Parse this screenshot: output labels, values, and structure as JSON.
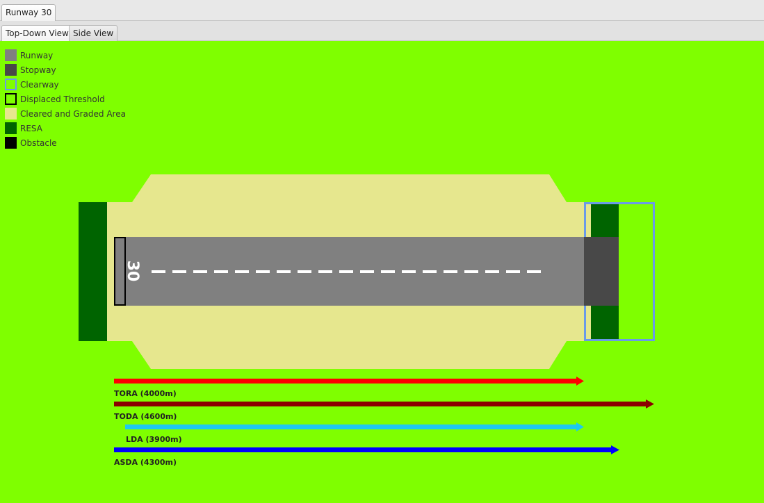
{
  "window": {
    "top_tab": "Runway 30",
    "view_tabs": [
      "Top-Down View",
      "Side View"
    ],
    "active_view": "Top-Down View"
  },
  "legend": [
    {
      "label": "Runway",
      "color": "#808080",
      "outline": false
    },
    {
      "label": "Stopway",
      "color": "#484848",
      "outline": false
    },
    {
      "label": "Clearway",
      "color": "#7fff00",
      "outline": true,
      "outline_color": "#6a9be8"
    },
    {
      "label": "Displaced Threshold",
      "color": "#7fff00",
      "outline": true,
      "outline_color": "#000000"
    },
    {
      "label": "Cleared and Graded Area",
      "color": "#e6e78e",
      "outline": false
    },
    {
      "label": "RESA",
      "color": "#006400",
      "outline": false
    },
    {
      "label": "Obstacle",
      "color": "#000000",
      "outline": false
    }
  ],
  "runway": {
    "designator": "30",
    "colors": {
      "background": "#7fff00",
      "runway": "#808080",
      "stopway": "#484848",
      "clearway_outline": "#6a9be8",
      "graded_area": "#e6e78e",
      "resa": "#006400",
      "threshold_outline": "#000000",
      "centerline": "#ffffff"
    }
  },
  "distances": [
    {
      "label": "TORA (4000m)",
      "color": "#ff0000",
      "value": 4000
    },
    {
      "label": "TODA (4600m)",
      "color": "#8b0000",
      "value": 4600
    },
    {
      "label": "LDA (3900m)",
      "color": "#1ec8f0",
      "value": 3900
    },
    {
      "label": "ASDA (4300m)",
      "color": "#0000ff",
      "value": 4300
    }
  ]
}
